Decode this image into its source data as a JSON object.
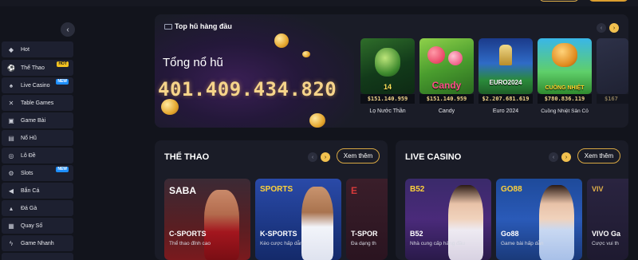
{
  "sidebar": {
    "items": [
      {
        "label": "Hot",
        "icon": "hot-icon"
      },
      {
        "label": "Thể Thao",
        "icon": "soccer-ball-icon",
        "badge": "HOT"
      },
      {
        "label": "Live Casino",
        "icon": "casino-chip-icon",
        "badge": "NEW"
      },
      {
        "label": "Table Games",
        "icon": "table-games-icon"
      },
      {
        "label": "Game Bài",
        "icon": "cards-icon"
      },
      {
        "label": "Nổ Hũ",
        "icon": "jackpot-icon"
      },
      {
        "label": "Lô Đề",
        "icon": "lottery-ball-icon"
      },
      {
        "label": "Slots",
        "icon": "slot-machine-icon",
        "badge": "NEW"
      },
      {
        "label": "Bắn Cá",
        "icon": "fish-icon"
      },
      {
        "label": "Đá Gà",
        "icon": "rooster-icon"
      },
      {
        "label": "Quay Số",
        "icon": "number-wheel-icon"
      },
      {
        "label": "Game Nhanh",
        "icon": "lightning-icon"
      }
    ]
  },
  "jackpot": {
    "title": "Top hũ hàng đầu",
    "label": "Tổng nổ hũ",
    "amount": "401.409.434.820",
    "games": [
      {
        "name": "Lọ Nước Thần",
        "prize": "$151.140.959",
        "art": "14"
      },
      {
        "name": "Candy",
        "prize": "$151.140.959",
        "art": "Candy"
      },
      {
        "name": "Euro 2024",
        "prize": "$2.207.681.619",
        "art": "EURO2024"
      },
      {
        "name": "Cuồng Nhiệt Sân Cỏ",
        "prize": "$780.836.119",
        "art": "CUỒNG NHIỆT"
      }
    ],
    "partial_prize": "$167"
  },
  "sports": {
    "title": "THỂ THAO",
    "more": "Xem thêm",
    "cards": [
      {
        "logo": "SABA",
        "name": "C-SPORTS",
        "desc": "Thể thao đỉnh cao"
      },
      {
        "logo": "SPORTS",
        "name": "K-SPORTS",
        "desc": "Kèo cược hấp dẫn"
      },
      {
        "logo": "E",
        "name": "T-SPOR",
        "desc": "Đa dạng th"
      }
    ]
  },
  "casino": {
    "title": "LIVE CASINO",
    "more": "Xem thêm",
    "cards": [
      {
        "logo": "B52",
        "name": "B52",
        "desc": "Nhà cung cấp hàng đầu"
      },
      {
        "logo": "GO88",
        "name": "Go88",
        "desc": "Game bài hấp dẫn"
      },
      {
        "logo": "VIV",
        "name": "VIVO Ga",
        "desc": "Cược vui th"
      }
    ]
  },
  "colors": {
    "accent": "#f2c14f",
    "panel": "#1a1c27",
    "sidebar_item": "#1d2030"
  }
}
